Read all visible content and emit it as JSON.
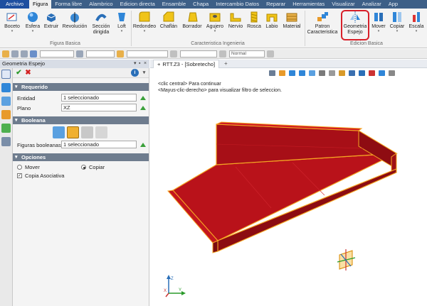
{
  "menu": {
    "items": [
      "Archivo",
      "Figura",
      "Forma libre",
      "Alambrico",
      "Edicion directa",
      "Ensamble",
      "Chapa",
      "Intercambio Datos",
      "Reparar",
      "Herramientas",
      "Visualizar",
      "Analizar",
      "App"
    ]
  },
  "ribbon": {
    "figura_basica": {
      "label": "Figura Basica",
      "buttons": [
        "Boceto",
        "Esfera",
        "Extruir",
        "Revolución",
        "Sección dirigida",
        "Loft"
      ]
    },
    "caracteristica_ingenieria": {
      "label": "Caracteristica Ingenieria",
      "buttons": [
        "Redondeo",
        "Chaflán",
        "Borrador",
        "Agujero",
        "Nervio",
        "Rosca",
        "Labio",
        "Material"
      ]
    },
    "edicion_basica": {
      "label": "Edicion Basica",
      "buttons": [
        "Patron Caracteristica",
        "Geometria Espejo",
        "Mover",
        "Copiar",
        "Escala"
      ]
    }
  },
  "toolbar": {
    "style_value": "Normal"
  },
  "panel": {
    "title": "Geometria Espejo",
    "requerido": {
      "header": "Requerido",
      "entidad_label": "Entidad",
      "entidad_value": "1 seleccionado",
      "plano_label": "Plano",
      "plano_value": "XZ"
    },
    "booleana": {
      "header": "Booleana",
      "figuras_label": "Figuras booleanas",
      "figuras_value": "1 seleccionado"
    },
    "opciones": {
      "header": "Opciones",
      "mover": "Mover",
      "copiar": "Copiar",
      "copia_asociativa": "Copia Asociativa",
      "selected": "Copiar"
    }
  },
  "document": {
    "tab": "RTT.Z3 - [Sobretecho]",
    "hint1": "<clic central> Para continuar",
    "hint2": "<Mayus-clic-derecho> para visualizar filtro de seleccion."
  },
  "colors": {
    "menubar": "#3d5f87",
    "part_fill": "#c0141c",
    "part_edge": "#f5a623",
    "highlight": "#d8202a"
  }
}
